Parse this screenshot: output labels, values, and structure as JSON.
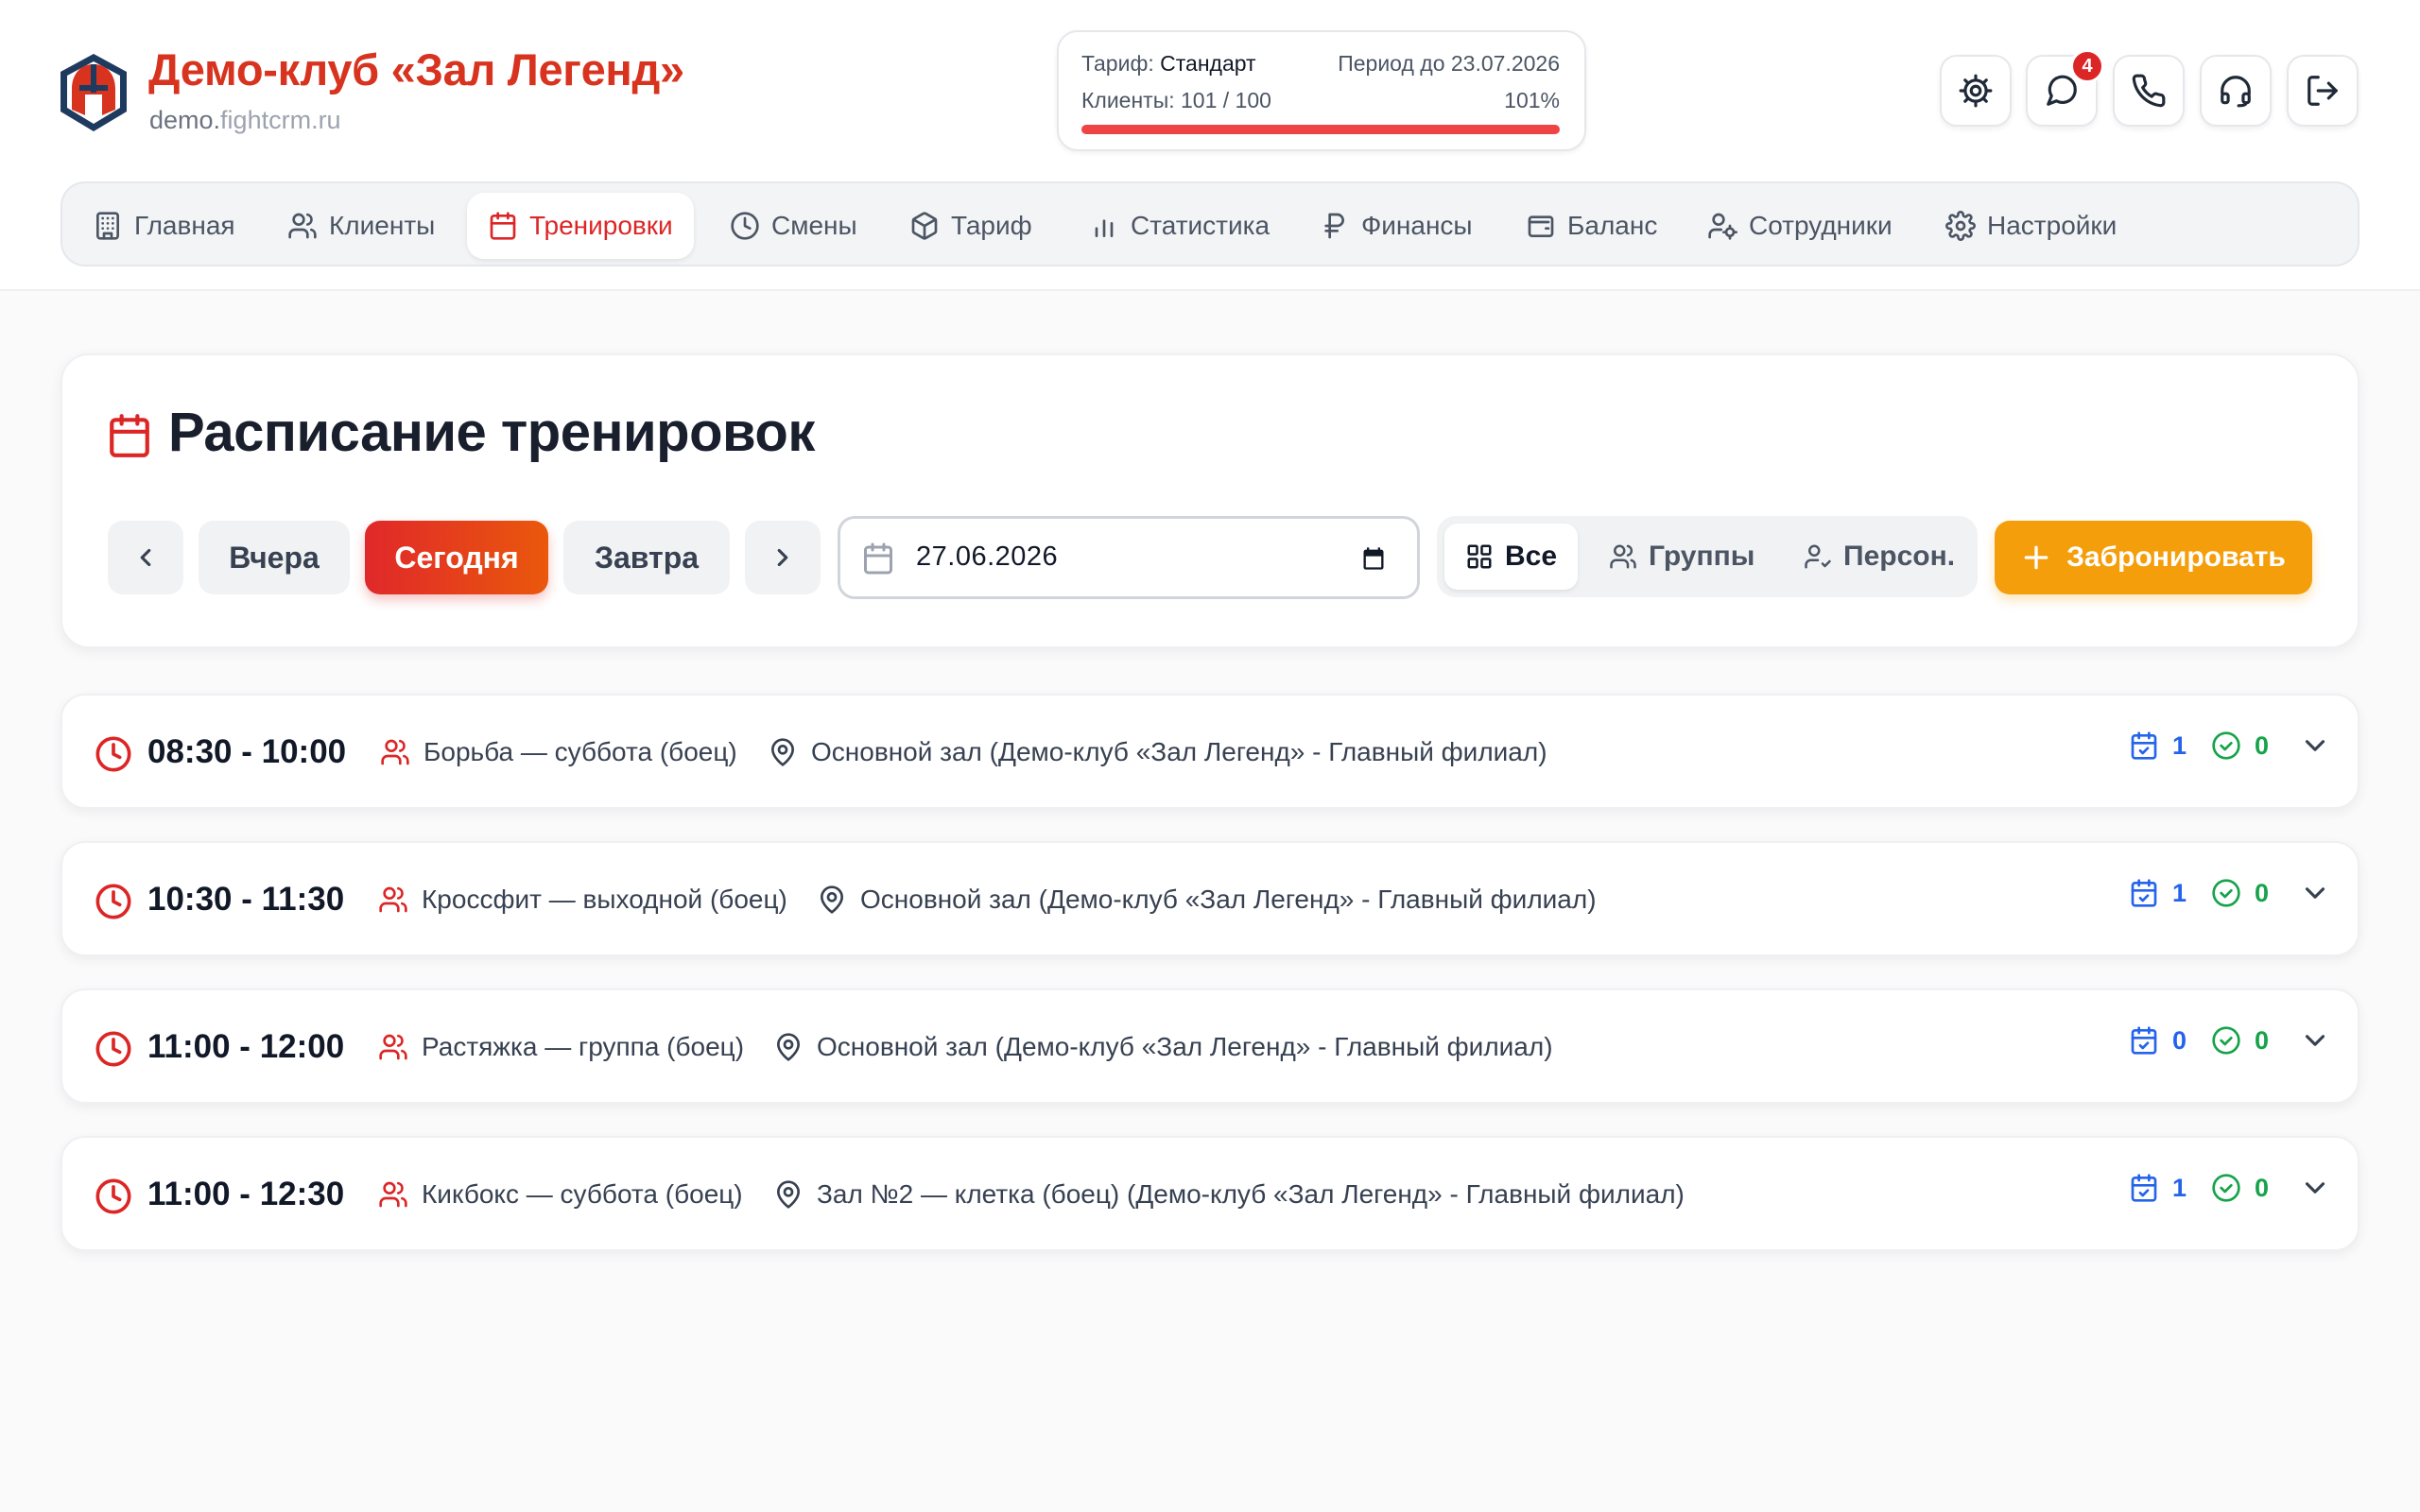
{
  "club": {
    "name": "Демо-клуб «Зал Легенд»",
    "domain_prefix": "demo.",
    "domain_suffix": "fightcrm.ru"
  },
  "plan": {
    "tariff_label": "Тариф:",
    "tariff_value": "Стандарт",
    "period": "Период до 23.07.2026",
    "clients_label": "Клиенты:",
    "clients_value": "101 / 100",
    "usage_percent": "101%",
    "usage_fraction": 1.0
  },
  "toolbar": {
    "notifications_count": "4"
  },
  "nav": [
    {
      "label": "Главная",
      "icon": "building-icon"
    },
    {
      "label": "Клиенты",
      "icon": "users-icon"
    },
    {
      "label": "Тренировки",
      "icon": "calendar-icon",
      "active": true
    },
    {
      "label": "Смены",
      "icon": "clock-icon"
    },
    {
      "label": "Тариф",
      "icon": "box-icon"
    },
    {
      "label": "Статистика",
      "icon": "bar-chart-icon"
    },
    {
      "label": "Финансы",
      "icon": "ruble-icon"
    },
    {
      "label": "Баланс",
      "icon": "wallet-icon"
    },
    {
      "label": "Сотрудники",
      "icon": "user-cog-icon"
    },
    {
      "label": "Настройки",
      "icon": "settings-icon"
    }
  ],
  "schedule": {
    "title": "Расписание тренировок",
    "yesterday": "Вчера",
    "today": "Сегодня",
    "tomorrow": "Завтра",
    "date": "27.06.2026",
    "filters": {
      "all": "Все",
      "groups": "Группы",
      "personal": "Персон."
    },
    "book": "Забронировать"
  },
  "sessions": [
    {
      "time": "08:30 - 10:00",
      "name": "Борьба — суббота (боец)",
      "location": "Основной зал (Демо-клуб «Зал Легенд» - Главный филиал)",
      "booked": "1",
      "attended": "0"
    },
    {
      "time": "10:30 - 11:30",
      "name": "Кроссфит — выходной (боец)",
      "location": "Основной зал (Демо-клуб «Зал Легенд» - Главный филиал)",
      "booked": "1",
      "attended": "0"
    },
    {
      "time": "11:00 - 12:00",
      "name": "Растяжка — группа (боец)",
      "location": "Основной зал (Демо-клуб «Зал Легенд» - Главный филиал)",
      "booked": "0",
      "attended": "0"
    },
    {
      "time": "11:00 - 12:30",
      "name": "Кикбокс — суббота (боец)",
      "location": "Зал №2 — клетка (боец) (Демо-клуб «Зал Легенд» - Главный филиал)",
      "booked": "1",
      "attended": "0"
    }
  ],
  "colors": {
    "brand": "#d7331f",
    "accent": "#f59e0b",
    "danger": "#dc2626",
    "info": "#2563eb",
    "success": "#16a34a"
  }
}
